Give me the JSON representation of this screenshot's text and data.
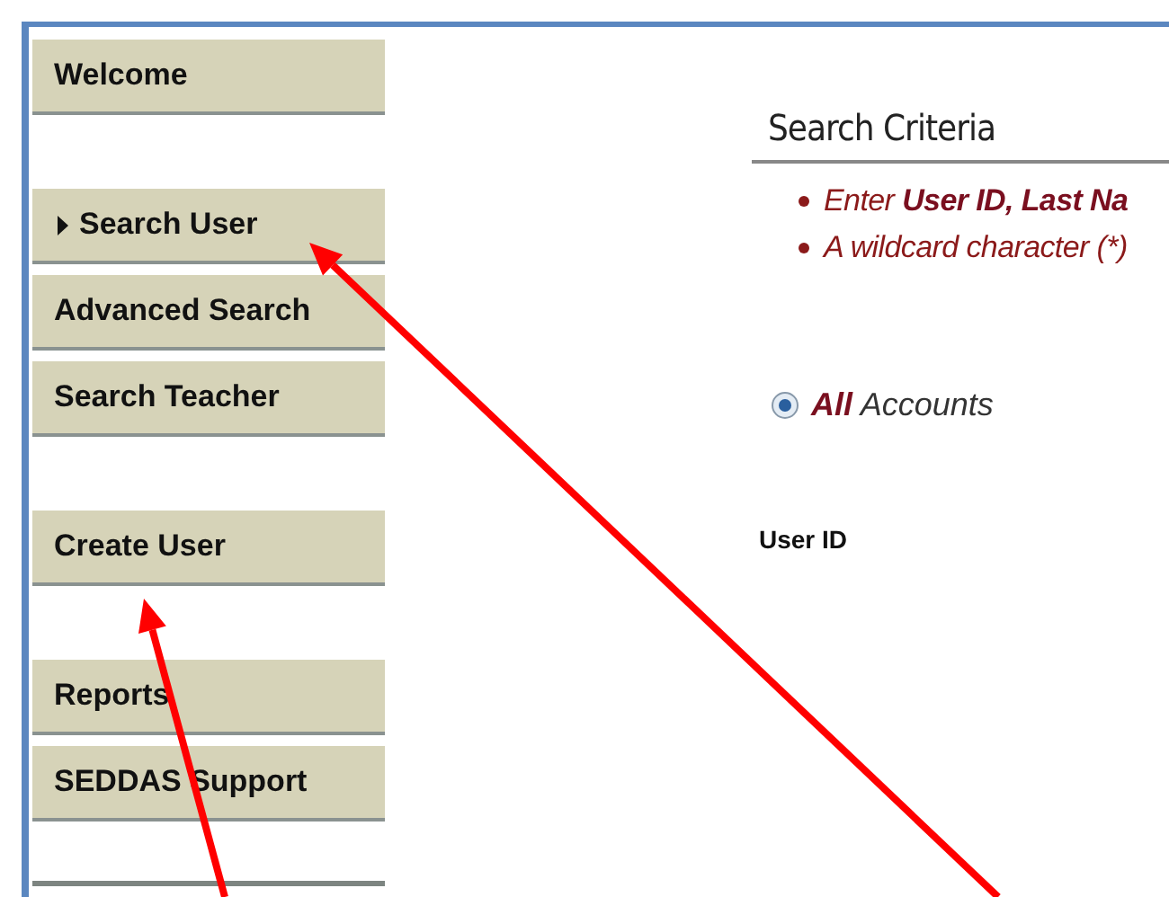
{
  "sidebar": {
    "groups": [
      {
        "items": [
          {
            "label": "Welcome",
            "selected": false
          }
        ]
      },
      {
        "items": [
          {
            "label": "Search User",
            "selected": true
          },
          {
            "label": "Advanced Search",
            "selected": false
          },
          {
            "label": "Search Teacher",
            "selected": false
          }
        ]
      },
      {
        "items": [
          {
            "label": "Create User",
            "selected": false
          }
        ]
      },
      {
        "items": [
          {
            "label": "Reports",
            "selected": false
          },
          {
            "label": "SEDDAS Support",
            "selected": false
          }
        ]
      }
    ]
  },
  "search_criteria": {
    "title": "Search Criteria",
    "instructions": [
      "Enter **User ID, Last Na**",
      "A wildcard character (*)"
    ],
    "account_options": [
      {
        "label": "**All** Accounts",
        "selected": true
      }
    ],
    "fields": [
      {
        "label": "User ID"
      }
    ]
  }
}
